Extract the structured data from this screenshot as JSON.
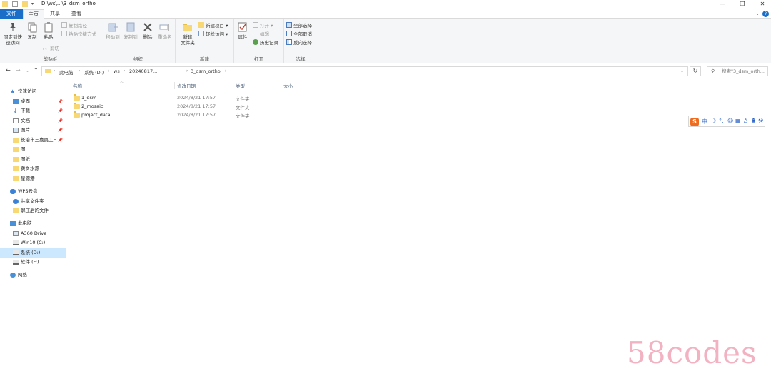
{
  "window": {
    "title": "D:\\ws\\...\\3_dsm_ortho",
    "minimize": "—",
    "maximize": "❐",
    "close": "✕"
  },
  "tabs": {
    "file": "文件",
    "home": "主页",
    "share": "共享",
    "view": "查看"
  },
  "ribbon": {
    "clipboard": {
      "label": "剪贴板",
      "pin": "固定到快\n速访问",
      "copy": "复制",
      "paste": "粘贴",
      "copy_path": "复制路径",
      "paste_shortcut": "粘贴快捷方式",
      "cut": "剪切"
    },
    "organize": {
      "label": "组织",
      "move_to": "移动到",
      "copy_to": "复制到",
      "delete": "删除",
      "rename": "重命名"
    },
    "new": {
      "label": "新建",
      "new_folder": "新建\n文件夹",
      "new_item": "新建项目 ▾",
      "easy_access": "轻松访问 ▾"
    },
    "open": {
      "label": "打开",
      "properties": "属性",
      "open": "打开 ▾",
      "edit": "编辑",
      "history": "历史记录"
    },
    "select": {
      "label": "选择",
      "select_all": "全部选择",
      "select_none": "全部取消",
      "invert": "反向选择"
    }
  },
  "address": {
    "crumbs": [
      "此电脑",
      "系统 (D:)",
      "ws",
      "20240817...",
      "3_dsm_ortho"
    ],
    "search_placeholder": "搜索\"3_dsm_orth..."
  },
  "navpane": {
    "quick_access": "快速访问",
    "desktop": "桌面",
    "downloads": "下载",
    "documents": "文档",
    "pictures": "图片",
    "folder1": "长治市三嘉奥工E",
    "folder2": "图",
    "folder3": "图纸",
    "folder4": "黄乡水源",
    "folder5": "星源港",
    "wps": "WPS云盘",
    "shared": "共享文件夹",
    "unzipped": "解压后的文件",
    "this_pc": "此电脑",
    "a360": "A360 Drive",
    "win10": "Win10 (C:)",
    "system_d": "系统 (D:)",
    "software_e": "软件 (F:)",
    "network": "网络"
  },
  "columns": {
    "name": "名称",
    "date": "修改日期",
    "type": "类型",
    "size": "大小"
  },
  "files": [
    {
      "name": "1_dsm",
      "date": "2024/8/21 17:57",
      "type": "文件夹"
    },
    {
      "name": "2_mosaic",
      "date": "2024/8/21 17:57",
      "type": "文件夹"
    },
    {
      "name": "project_data",
      "date": "2024/8/21 17:57",
      "type": "文件夹"
    }
  ],
  "ime": {
    "logo": "S",
    "mode": "中"
  },
  "watermark": "58codes"
}
